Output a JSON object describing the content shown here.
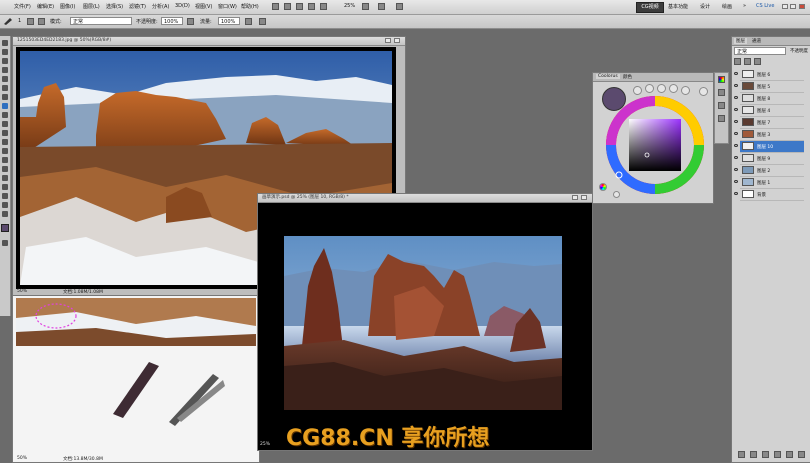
{
  "menubar": {
    "items": [
      "文件(F)",
      "编辑(E)",
      "图像(I)",
      "图层(L)",
      "选择(S)",
      "滤镜(T)",
      "分析(A)",
      "3D(D)",
      "视图(V)",
      "窗口(W)",
      "帮助(H)"
    ],
    "zoom": "25%",
    "workspace_badge": "CG视频",
    "workspace_basic": "基本功能",
    "workspace_design": "设计",
    "workspace_paint": "绘画",
    "cs_live": "CS Live"
  },
  "optbar": {
    "brush_size": "1",
    "mode_label": "模式:",
    "mode_value": "正常",
    "opacity_label": "不透明度:",
    "opacity_value": "100%",
    "flow_label": "流量:",
    "flow_value": "100%"
  },
  "doc_photo": {
    "title": "1251503ED4ED2183.jpg @ 50%(RGB/8#)",
    "status_zoom": "50%",
    "status_text": "文档:1.08M/1.08M"
  },
  "doc_small": {
    "status_zoom": "50%",
    "status_text": "文档:13.8M/30.8M"
  },
  "doc_painting": {
    "title": "画草演示.psd @ 25% (图层 10, RGB/8) *",
    "status_zoom": "25%"
  },
  "color_panel": {
    "tab1": "Coolorus",
    "tab2": "颜色"
  },
  "layers_panel": {
    "tab1": "图层",
    "tab2": "通道",
    "blend_mode": "正常",
    "opacity_label": "不透明度",
    "layers": [
      {
        "name": "图层 6",
        "selected": false
      },
      {
        "name": "图层 5",
        "selected": false
      },
      {
        "name": "图层 8",
        "selected": false
      },
      {
        "name": "图层 4",
        "selected": false
      },
      {
        "name": "图层 7",
        "selected": false
      },
      {
        "name": "图层 3",
        "selected": false
      },
      {
        "name": "图层 10",
        "selected": true
      },
      {
        "name": "图层 9",
        "selected": false
      },
      {
        "name": "图层 2",
        "selected": false
      },
      {
        "name": "图层 1",
        "selected": false
      },
      {
        "name": "背景",
        "selected": false
      }
    ]
  },
  "watermark": "CG88.CN 享你所想",
  "colors": {
    "accent": "#3d78c8",
    "foreground_swatch": "#5b4a6e",
    "watermark": "#e8a020"
  }
}
